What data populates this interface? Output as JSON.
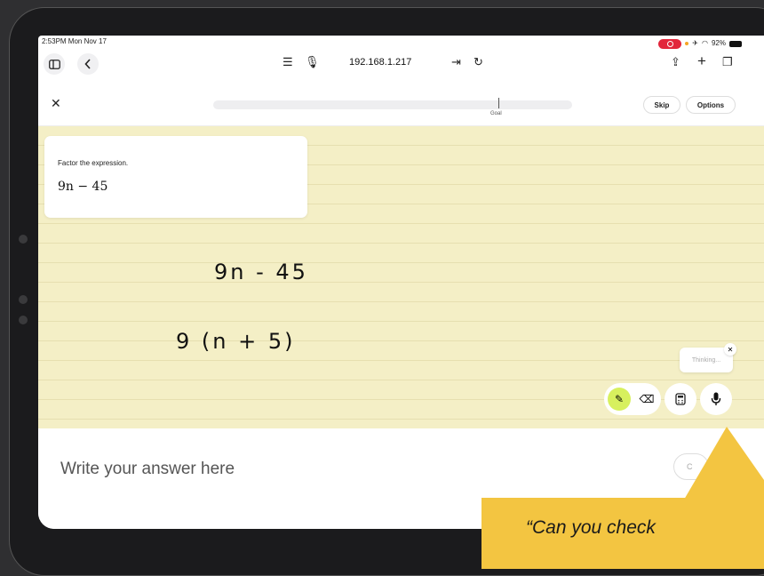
{
  "status_bar": {
    "time_date": "2:53PM  Mon Nov 17",
    "battery": "92%"
  },
  "browser": {
    "url": "192.168.1.217"
  },
  "lesson": {
    "goal_label": "Goal",
    "progress": 0.0,
    "skip_label": "Skip",
    "options_label": "Options"
  },
  "question": {
    "prompt": "Factor the expression.",
    "expression": "9n − 45"
  },
  "handwriting": {
    "line1": "9n - 45",
    "line2": "9 (n + 5)"
  },
  "assistant": {
    "status": "Thinking..."
  },
  "answer": {
    "placeholder": "Write your answer here",
    "check_label": "C"
  },
  "callout": {
    "text": "“Can you check"
  },
  "colors": {
    "paper": "#f4efc6",
    "pencil_active": "#d7f05e",
    "callout": "#f3c541",
    "recording": "#e2263b"
  },
  "icons": [
    "sidebar-icon",
    "back-icon",
    "reader-icon",
    "microphone-icon",
    "extension-icon",
    "reload-icon",
    "share-icon",
    "plus-icon",
    "tabs-icon",
    "close-icon",
    "pencil-icon",
    "eraser-icon",
    "calculator-icon"
  ]
}
